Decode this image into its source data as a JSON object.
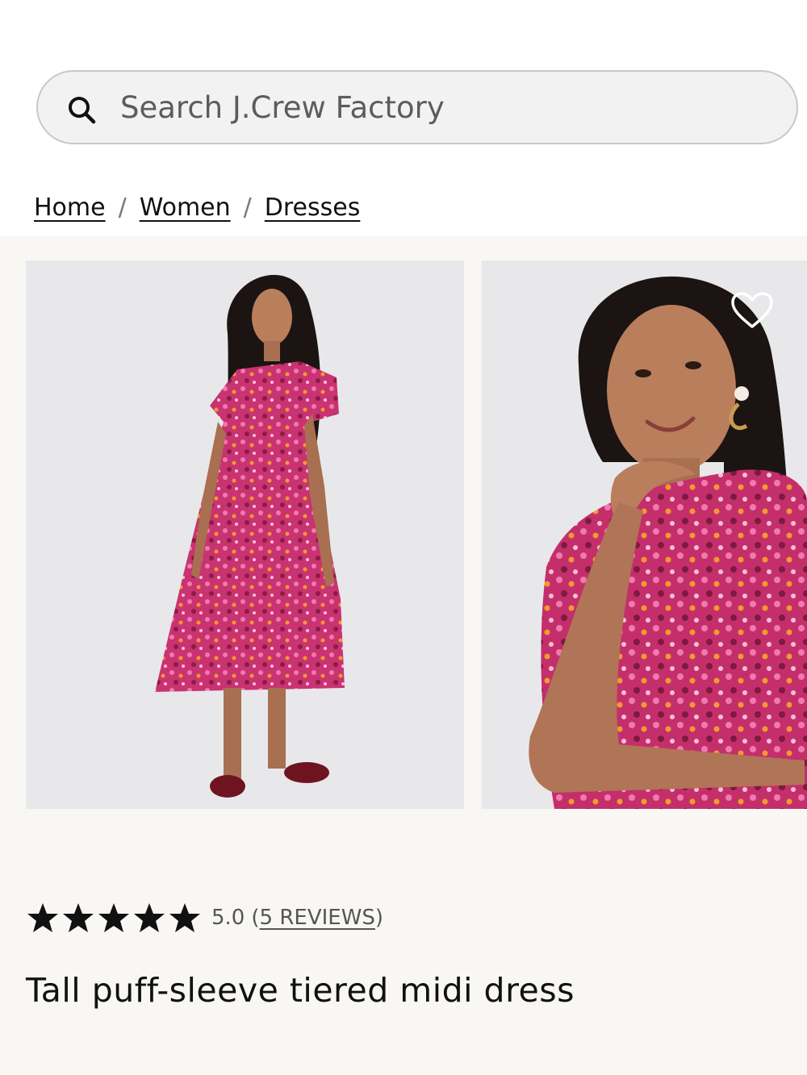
{
  "search": {
    "placeholder": "Search J.Crew Factory",
    "icon": "search-icon"
  },
  "breadcrumb": {
    "items": [
      "Home",
      "Women",
      "Dresses"
    ],
    "separator": "/"
  },
  "gallery": {
    "images": [
      {
        "name": "product-image-full-length",
        "alt": ""
      },
      {
        "name": "product-image-close-up",
        "alt": ""
      }
    ],
    "wishlist_icon": "heart-icon"
  },
  "product": {
    "rating": {
      "stars": 5,
      "max": 5,
      "value": "5.0",
      "reviews_open": "(",
      "reviews_label": "5 REVIEWS",
      "reviews_close": ")"
    },
    "title": "Tall puff-sleeve tiered midi dress"
  },
  "colors": {
    "search_bg": "#f2f2f2",
    "gallery_bg": "#f8f7f4",
    "dress_pink": "#d23a7a",
    "star": "#111111"
  }
}
